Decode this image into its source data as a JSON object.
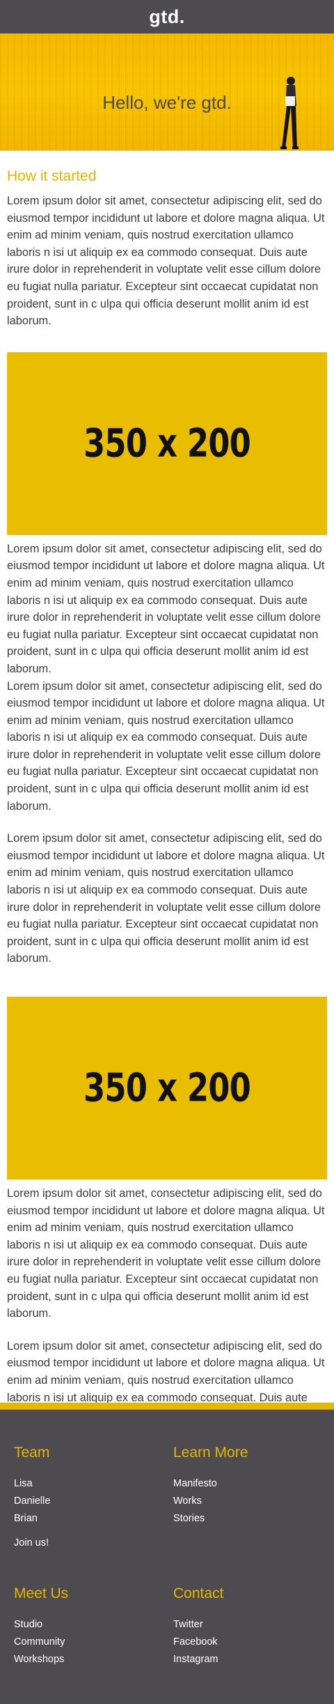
{
  "header": {
    "brand": "gtd."
  },
  "hero": {
    "title": "Hello, we're gtd."
  },
  "main": {
    "section_title": "How it started",
    "paragraphs": [
      "Lorem ipsum dolor sit amet, consectetur adipiscing elit, sed do eiusmod tempor incididunt ut labore et dolore magna aliqua. Ut enim ad minim veniam, quis nostrud exercitation ullamco laboris n isi ut aliquip ex ea commodo consequat. Duis aute irure dolor in reprehenderit in voluptate velit esse cillum dolore eu fugiat nulla pariatur. Excepteur sint occaecat cupidatat non proident, sunt in c ulpa qui officia deserunt mollit anim id est laborum.",
      "Lorem ipsum dolor sit amet, consectetur adipiscing elit, sed do eiusmod tempor incididunt ut labore et dolore magna aliqua. Ut enim ad minim veniam, quis nostrud exercitation ullamco laboris n isi ut aliquip ex ea commodo consequat. Duis aute irure dolor in reprehenderit in voluptate velit esse cillum dolore eu fugiat nulla pariatur. Excepteur sint occaecat cupidatat non proident, sunt in c ulpa qui officia deserunt mollit anim id est laborum.",
      "Lorem ipsum dolor sit amet, consectetur adipiscing elit, sed do eiusmod tempor incididunt ut labore et dolore magna aliqua. Ut enim ad minim veniam, quis nostrud exercitation ullamco laboris n isi ut aliquip ex ea commodo consequat. Duis aute irure dolor in reprehenderit in voluptate velit esse cillum dolore eu fugiat nulla pariatur. Excepteur sint occaecat cupidatat non proident, sunt in c ulpa qui officia deserunt mollit anim id est laborum.",
      "Lorem ipsum dolor sit amet, consectetur adipiscing elit, sed do eiusmod tempor incididunt ut labore et dolore magna aliqua. Ut enim ad minim veniam, quis nostrud exercitation ullamco laboris n isi ut aliquip ex ea commodo consequat. Duis aute irure dolor in reprehenderit in voluptate velit esse cillum dolore eu fugiat nulla pariatur. Excepteur sint occaecat cupidatat non proident, sunt in c ulpa qui officia deserunt mollit anim id est laborum.",
      "Lorem ipsum dolor sit amet, consectetur adipiscing elit, sed do eiusmod tempor incididunt ut labore et dolore magna aliqua. Ut enim ad minim veniam, quis nostrud exercitation ullamco laboris n isi ut aliquip ex ea commodo consequat. Duis aute irure dolor in reprehenderit in voluptate velit esse cillum dolore eu fugiat nulla pariatur. Excepteur sint occaecat cupidatat non proident, sunt in c ulpa qui officia deserunt mollit anim id est laborum.",
      "Lorem ipsum dolor sit amet, consectetur adipiscing elit, sed do eiusmod tempor incididunt ut labore et dolore magna aliqua. Ut enim ad minim veniam, quis nostrud exercitation ullamco laboris n isi ut aliquip ex ea commodo consequat. Duis aute irure dolor in reprehenderit in voluptate velit esse cillum dolore eu fugiat nulla pariatur. Excepteur sint occaecat cupidatat non proident, sunt in c ulpa qui officia deserunt mollit anim id est laborum."
    ],
    "placeholder_images": [
      "350 x 200",
      "350 x 200"
    ]
  },
  "footer": {
    "team": {
      "heading": "Team",
      "items": [
        "Lisa",
        "Danielle",
        "Brian"
      ],
      "join": "Join us!"
    },
    "learn_more": {
      "heading": "Learn More",
      "items": [
        "Manifesto",
        "Works",
        "Stories"
      ]
    },
    "meet_us": {
      "heading": "Meet Us",
      "items": [
        "Studio",
        "Community",
        "Workshops"
      ]
    },
    "contact": {
      "heading": "Contact",
      "items": [
        "Twitter",
        "Facebook",
        "Instagram"
      ]
    }
  },
  "colors": {
    "header_bg": "#4d4b4f",
    "accent": "#e7b700",
    "hero_bg": "#f5b900",
    "text": "#3a3a3a"
  }
}
